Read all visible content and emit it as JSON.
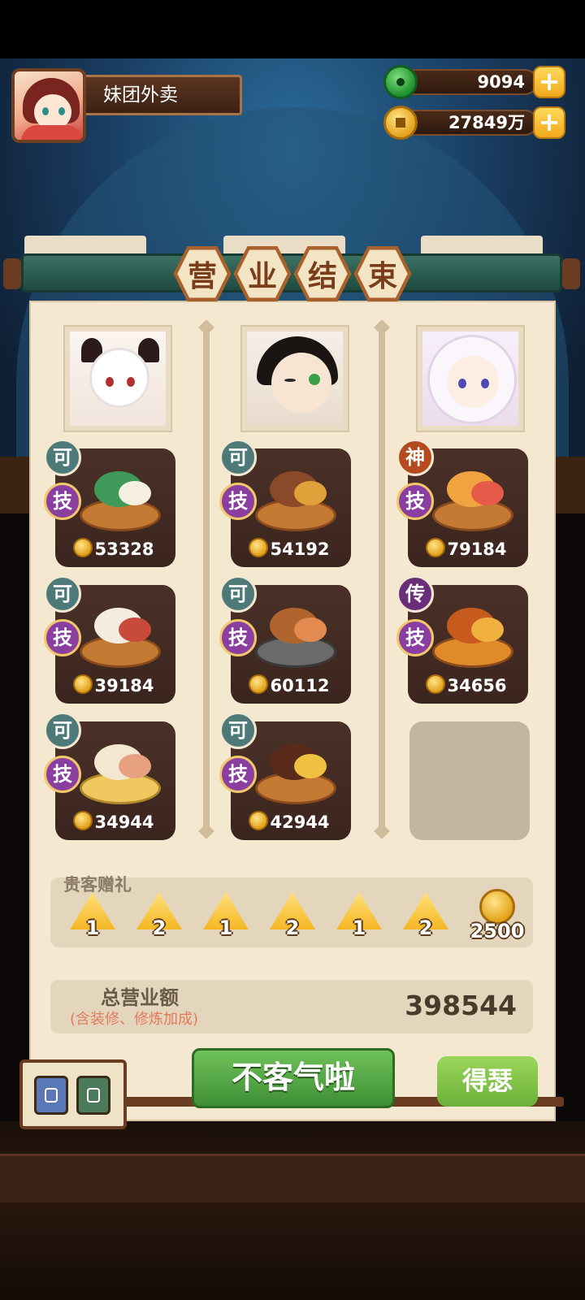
{
  "profile": {
    "name": "妹团外卖"
  },
  "currency": {
    "jade": "9094",
    "gold": "27849万"
  },
  "title": [
    "营",
    "业",
    "结",
    "束"
  ],
  "dishes": [
    {
      "badge_top": "可",
      "badge_skill": "技",
      "price": "53328"
    },
    {
      "badge_top": "可",
      "badge_skill": "技",
      "price": "54192"
    },
    {
      "badge_top": "神",
      "badge_skill": "技",
      "price": "79184"
    },
    {
      "badge_top": "可",
      "badge_skill": "技",
      "price": "39184"
    },
    {
      "badge_top": "可",
      "badge_skill": "技",
      "price": "60112"
    },
    {
      "badge_top": "传",
      "badge_skill": "技",
      "price": "34656"
    },
    {
      "badge_top": "可",
      "badge_skill": "技",
      "price": "34944"
    },
    {
      "badge_top": "可",
      "badge_skill": "技",
      "price": "42944"
    }
  ],
  "gifts": {
    "label": "贵客赠礼",
    "items": [
      "1",
      "2",
      "1",
      "2",
      "1",
      "2"
    ],
    "coins": "2500"
  },
  "total": {
    "label": "总营业额",
    "note": "(含装修、修炼加成)",
    "value": "398544"
  },
  "buttons": {
    "main": "不客气啦",
    "side": "得瑟"
  }
}
